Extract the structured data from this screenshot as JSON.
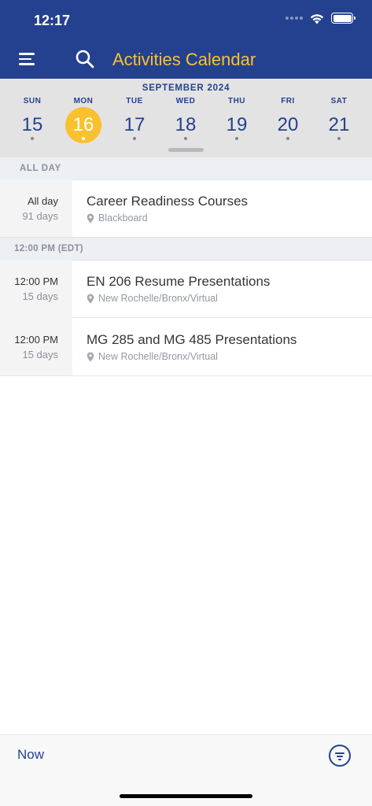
{
  "status_bar": {
    "time": "12:17"
  },
  "header": {
    "title": "Activities Calendar",
    "title_color": "#f9c12f",
    "bg_color": "#24418f",
    "menu_icon": "hamburger-menu-icon",
    "search_icon": "search-icon"
  },
  "week": {
    "month": "SEPTEMBER 2024",
    "days": [
      {
        "name": "SUN",
        "num": "15"
      },
      {
        "name": "MON",
        "num": "16",
        "selected": true
      },
      {
        "name": "TUE",
        "num": "17"
      },
      {
        "name": "WED",
        "num": "18"
      },
      {
        "name": "THU",
        "num": "19"
      },
      {
        "name": "FRI",
        "num": "20"
      },
      {
        "name": "SAT",
        "num": "21"
      }
    ]
  },
  "sections": [
    {
      "header": "ALL DAY",
      "events": [
        {
          "time": "All day",
          "duration": "91 days",
          "title": "Career Readiness Courses",
          "location": "Blackboard"
        }
      ]
    },
    {
      "header": "12:00 PM (EDT)",
      "events": [
        {
          "time": "12:00 PM",
          "duration": "15 days",
          "title": "EN 206 Resume Presentations",
          "location": "New Rochelle/Bronx/Virtual"
        },
        {
          "time": "12:00 PM",
          "duration": "15 days",
          "title": "MG 285 and MG 485 Presentations",
          "location": "New Rochelle/Bronx/Virtual"
        }
      ]
    }
  ],
  "bottom_bar": {
    "now_label": "Now",
    "filter_icon": "filter-icon"
  }
}
